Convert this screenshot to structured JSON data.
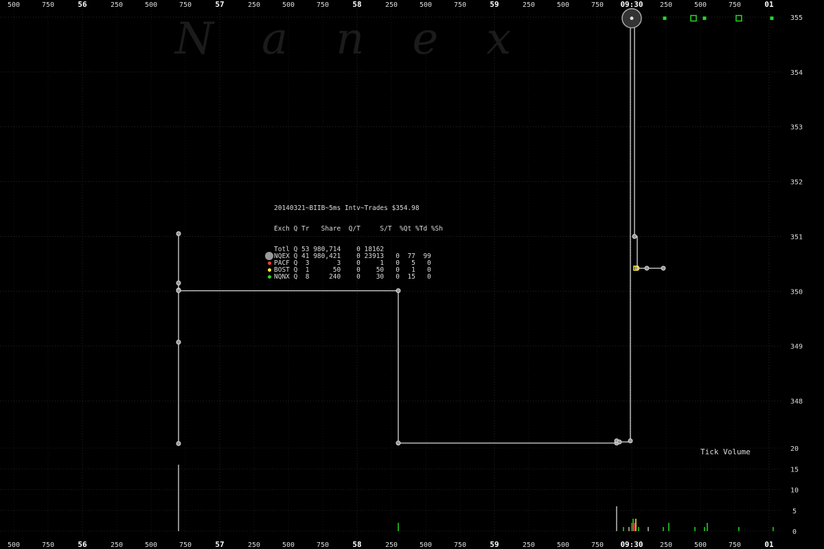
{
  "watermark": "Nanex",
  "info_panel": {
    "title": "20140321~BIIB~5ms Intv~Trades $354.98",
    "header": "Exch Q Tr   Share  Q/T     S/T  %Qt %Td %Sh",
    "rows": [
      {
        "label": "Totl Q 53 980,714    0 18162",
        "marker": "none",
        "color": ""
      },
      {
        "label": "NQEX Q 41 980,421    0 23913   0  77  99",
        "marker": "big",
        "color": "#9a9a9a"
      },
      {
        "label": "PACF Q  3       3    0     1   0   5   0",
        "marker": "dot",
        "color": "#ff3b3b"
      },
      {
        "label": "BOST Q  1      50    0    50   0   1   0",
        "marker": "dot",
        "color": "#ffee33"
      },
      {
        "label": "NQNX Q  8     240    0    30   0  15   0",
        "marker": "dot",
        "color": "#22dd22"
      }
    ]
  },
  "volume_label": "Tick Volume",
  "chart_data": [
    {
      "type": "line",
      "title": "",
      "x_tick_labels_top": [
        "500",
        "750",
        "56",
        "250",
        "500",
        "750",
        "57",
        "250",
        "500",
        "750",
        "58",
        "250",
        "500",
        "750",
        "59",
        "250",
        "500",
        "750",
        "09:30",
        "250",
        "500",
        "750",
        "01"
      ],
      "x_tick_labels_bottom": [
        "500",
        "750",
        "56",
        "250",
        "500",
        "750",
        "57",
        "250",
        "500",
        "750",
        "58",
        "250",
        "500",
        "750",
        "59",
        "250",
        "500",
        "750",
        "09:30",
        "250",
        "500",
        "750",
        "01"
      ],
      "x_major_labels": [
        "56",
        "57",
        "58",
        "59",
        "09:30",
        "01"
      ],
      "x_range_seconds": [
        -4.5,
        1.05
      ],
      "y_tick_labels": [
        "348",
        "349",
        "350",
        "351",
        "352",
        "353",
        "354",
        "355"
      ],
      "ylim": [
        347.15,
        355.0
      ],
      "series": [
        {
          "exchange": "NQEX",
          "color": "#bdbdbd",
          "points": [
            {
              "t": -3.3,
              "p": 351.05
            },
            {
              "t": -3.3,
              "p": 350.15
            },
            {
              "t": -3.3,
              "p": 350.02
            },
            {
              "t": -3.3,
              "p": 349.07
            },
            {
              "t": -3.3,
              "p": 347.22
            },
            {
              "t": -3.3,
              "p": 350.01
            },
            {
              "t": -1.7,
              "p": 350.01
            },
            {
              "t": -1.7,
              "p": 347.23
            },
            {
              "t": -0.11,
              "p": 347.23
            },
            {
              "t": -0.11,
              "p": 347.27
            },
            {
              "t": -0.09,
              "p": 347.25
            },
            {
              "t": -0.01,
              "p": 347.27
            },
            {
              "t": -0.01,
              "p": 354.98
            },
            {
              "t": 0.02,
              "p": 351.0
            },
            {
              "t": 0.04,
              "p": 350.42
            },
            {
              "t": 0.11,
              "p": 350.42
            },
            {
              "t": 0.23,
              "p": 350.42
            }
          ]
        },
        {
          "exchange": "NQNX",
          "color": "#22dd22",
          "points": [
            {
              "t": 0.24,
              "p": 354.98
            },
            {
              "t": 0.45,
              "p": 354.98
            },
            {
              "t": 0.53,
              "p": 354.98
            },
            {
              "t": 0.78,
              "p": 354.98
            },
            {
              "t": 1.02,
              "p": 354.98
            }
          ]
        }
      ]
    },
    {
      "type": "bar",
      "title": "Tick Volume",
      "y_tick_labels": [
        "0",
        "5",
        "10",
        "15",
        "20"
      ],
      "ylim": [
        0,
        20
      ],
      "bars": [
        {
          "t": -3.3,
          "v": 16,
          "color": "#bdbdbd"
        },
        {
          "t": -1.7,
          "v": 2,
          "color": "#22dd22"
        },
        {
          "t": -0.11,
          "v": 6,
          "color": "#bdbdbd"
        },
        {
          "t": -0.06,
          "v": 1,
          "color": "#22dd22"
        },
        {
          "t": -0.02,
          "v": 1,
          "color": "#bdbdbd"
        },
        {
          "t": 0.0,
          "v": 2,
          "color": "#ff3b3b"
        },
        {
          "t": 0.01,
          "v": 3,
          "color": "#22dd22"
        },
        {
          "t": 0.02,
          "v": 2,
          "color": "#ff3b3b"
        },
        {
          "t": 0.03,
          "v": 3,
          "color": "#ffee33"
        },
        {
          "t": 0.05,
          "v": 1,
          "color": "#22dd22"
        },
        {
          "t": 0.12,
          "v": 1,
          "color": "#bdbdbd"
        },
        {
          "t": 0.23,
          "v": 1,
          "color": "#22dd22"
        },
        {
          "t": 0.27,
          "v": 2,
          "color": "#22dd22"
        },
        {
          "t": 0.46,
          "v": 1,
          "color": "#22dd22"
        },
        {
          "t": 0.53,
          "v": 1,
          "color": "#22dd22"
        },
        {
          "t": 0.55,
          "v": 2,
          "color": "#22dd22"
        },
        {
          "t": 0.78,
          "v": 1,
          "color": "#22dd22"
        },
        {
          "t": 1.03,
          "v": 1,
          "color": "#22dd22"
        }
      ]
    }
  ]
}
